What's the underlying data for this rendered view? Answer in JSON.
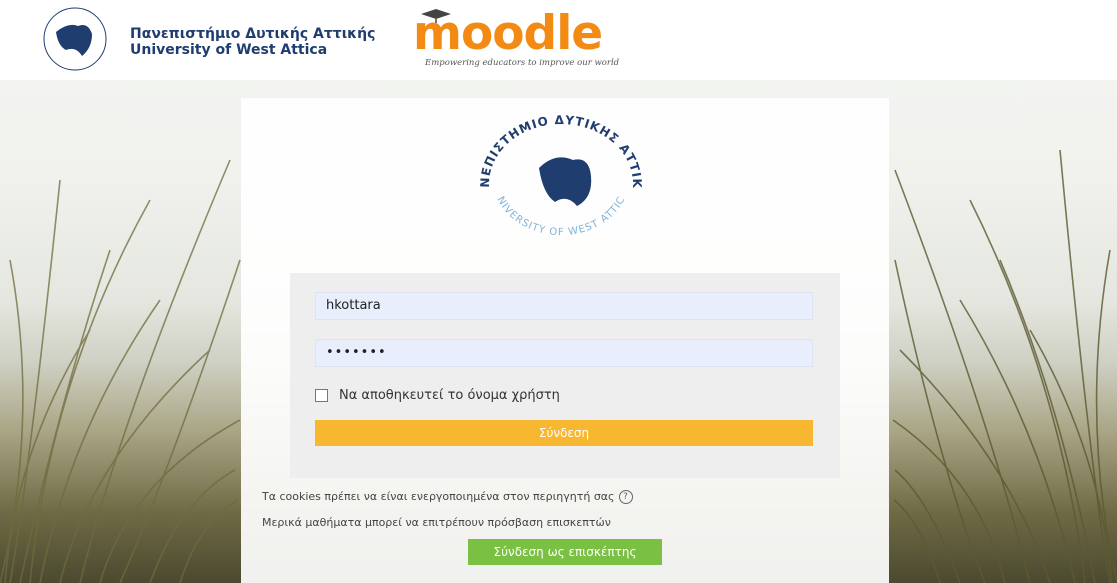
{
  "header": {
    "university_name_gr": "Πανεπιστήμιο Δυτικής Αττικής",
    "university_name_en": "University of West Attica",
    "moodle_wordmark": "moodle",
    "moodle_tagline": "Empowering educators to improve our world",
    "icons": {
      "university": "university-logo",
      "moodle": "moodle-logo"
    }
  },
  "seal": {
    "top_text": "ΠΑΝΕΠΙΣΤΗΜΙΟ ΔΥΤΙΚΗΣ ΑΤΤΙΚΗΣ",
    "bottom_text": "UNIVERSITY OF WEST ATTICA"
  },
  "login": {
    "username_value": "hkottara",
    "password_value": "•••••••",
    "remember_label": "Να αποθηκευτεί το όνομα χρήστη",
    "remember_checked": false,
    "submit_label": "Σύνδεση"
  },
  "notes": {
    "cookies": "Τα cookies πρέπει να είναι ενεργοποιημένα στον περιηγητή σας",
    "guests": "Μερικά μαθήματα μπορεί να επιτρέπουν πρόσβαση επισκεπτών"
  },
  "guest_button_label": "Σύνδεση ως επισκέπτης",
  "colors": {
    "login_button": "#f7b731",
    "guest_button": "#7ac143",
    "moodle_orange": "#f28a14",
    "university_blue": "#1f3d6e"
  }
}
